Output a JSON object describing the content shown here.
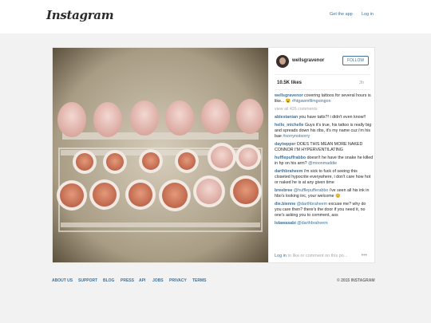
{
  "header": {
    "logo": "Instagram",
    "get_app": "Get the app",
    "log_in": "Log in"
  },
  "post": {
    "username": "wellsgravenor",
    "follow_label": "FOLLOW",
    "likes": "10.5K likes",
    "time": "3h",
    "caption_user": "wellsgravenor",
    "caption_text": " covering tattoos for several hours is like... ",
    "caption_emoji": "😵",
    "caption_tag": "#htgawmfilmgoingon",
    "view_all": "view all 426 comments",
    "comments": [
      {
        "user": "ablestanian",
        "text": " you have tatts?! i didn't even know!!",
        "mention": ""
      },
      {
        "user": "hello_michelle",
        "text": " Guys it's true, his tattoo is really big and spreads down his ribs, it's my name cuz i'm his bae ",
        "mention": "#sorrynotsorry"
      },
      {
        "user": "daytwpper",
        "text": " DOES THIS MEAN MORE NAKED CONNOR I'M HYPERVENTILATING",
        "mention": ""
      },
      {
        "user": "hufflepuffrabbo",
        "text": " doesn't he have the snake he killed in hp on his arm? ",
        "mention": "@moonmaddie"
      },
      {
        "user": "darthbraheem",
        "text": " i'm sick to fuck of seeing this closeted hypocrite everywhere, i don't care how hot or naked he is at any given time",
        "mention": ""
      },
      {
        "user": "breebree",
        "text": " i've seen all his ink in hbo's looking iirc, your welcome 😊",
        "mention": "@hufflepufferabbo"
      },
      {
        "user": "die.bienne",
        "text": " excuse me? why do you care then? there's the door if you need it, no one's asking you to comment, ass",
        "mention": "@darthbraheem"
      },
      {
        "user": "lolawasabi",
        "text": " ",
        "mention": "@darthbraheem"
      }
    ],
    "login_prompt": "Log in",
    "login_prompt_rest": " to like or comment on this po...",
    "more_icon": "ellipsis-icon"
  },
  "footer": {
    "links": [
      "ABOUT US",
      "SUPPORT",
      "BLOG",
      "PRESS",
      "API",
      "JOBS",
      "PRIVACY",
      "TERMS"
    ],
    "copyright": "© 2015 INSTAGRAM"
  },
  "colors": {
    "link": "#3f729b",
    "background": "#f2f2f2"
  }
}
